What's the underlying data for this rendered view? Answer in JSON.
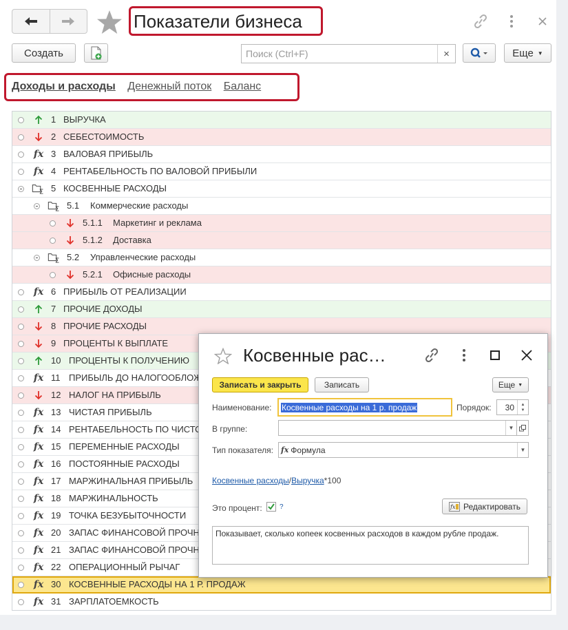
{
  "window": {
    "title": "Показатели бизнеса",
    "back_icon": "arrow-left-icon",
    "forward_icon": "arrow-right-icon"
  },
  "toolbar": {
    "create_label": "Создать",
    "search_placeholder": "Поиск (Ctrl+F)",
    "clear_label": "×",
    "more_label": "Еще"
  },
  "tabs": [
    {
      "label": "Доходы и расходы",
      "active": true
    },
    {
      "label": "Денежный поток",
      "active": false
    },
    {
      "label": "Баланс",
      "active": false
    }
  ],
  "rows": [
    {
      "num": "1",
      "name": "ВЫРУЧКА",
      "kind": "income",
      "icon": "arrow-up-icon",
      "level": 0
    },
    {
      "num": "2",
      "name": "СЕБЕСТОИМОСТЬ",
      "kind": "expense",
      "icon": "arrow-down-icon",
      "level": 0
    },
    {
      "num": "3",
      "name": "ВАЛОВАЯ ПРИБЫЛЬ",
      "kind": "formula",
      "icon": "fx-icon",
      "level": 0
    },
    {
      "num": "4",
      "name": "РЕНТАБЕЛЬНОСТЬ ПО ВАЛОВОЙ ПРИБЫЛИ",
      "kind": "formula",
      "icon": "fx-icon",
      "level": 0
    },
    {
      "num": "5",
      "name": "КОСВЕННЫЕ РАСХОДЫ",
      "kind": "group",
      "icon": "folder-sum-icon",
      "level": 0
    },
    {
      "num": "5.1",
      "name": "Коммерческие расходы",
      "kind": "group",
      "icon": "folder-sum-icon",
      "level": 1
    },
    {
      "num": "5.1.1",
      "name": "Маркетинг и реклама",
      "kind": "expense",
      "icon": "arrow-down-icon",
      "level": 2
    },
    {
      "num": "5.1.2",
      "name": "Доставка",
      "kind": "expense",
      "icon": "arrow-down-icon",
      "level": 2
    },
    {
      "num": "5.2",
      "name": "Управленческие расходы",
      "kind": "group",
      "icon": "folder-sum-icon",
      "level": 1
    },
    {
      "num": "5.2.1",
      "name": "Офисные расходы",
      "kind": "expense",
      "icon": "arrow-down-icon",
      "level": 2
    },
    {
      "num": "6",
      "name": "ПРИБЫЛЬ ОТ РЕАЛИЗАЦИИ",
      "kind": "formula",
      "icon": "fx-icon",
      "level": 0
    },
    {
      "num": "7",
      "name": "ПРОЧИЕ ДОХОДЫ",
      "kind": "income",
      "icon": "arrow-up-icon",
      "level": 0
    },
    {
      "num": "8",
      "name": "ПРОЧИЕ РАСХОДЫ",
      "kind": "expense",
      "icon": "arrow-down-icon",
      "level": 0
    },
    {
      "num": "9",
      "name": "ПРОЦЕНТЫ К ВЫПЛАТЕ",
      "kind": "expense",
      "icon": "arrow-down-icon",
      "level": 0
    },
    {
      "num": "10",
      "name": "ПРОЦЕНТЫ К ПОЛУЧЕНИЮ",
      "kind": "income",
      "icon": "arrow-up-icon",
      "level": 0
    },
    {
      "num": "11",
      "name": "ПРИБЫЛЬ ДО НАЛОГООБЛОЖ",
      "kind": "formula",
      "icon": "fx-icon",
      "level": 0
    },
    {
      "num": "12",
      "name": "НАЛОГ НА ПРИБЫЛЬ",
      "kind": "expense",
      "icon": "arrow-down-icon",
      "level": 0
    },
    {
      "num": "13",
      "name": "ЧИСТАЯ ПРИБЫЛЬ",
      "kind": "formula",
      "icon": "fx-icon",
      "level": 0
    },
    {
      "num": "14",
      "name": "РЕНТАБЕЛЬНОСТЬ ПО ЧИСТО",
      "kind": "formula",
      "icon": "fx-icon",
      "level": 0
    },
    {
      "num": "15",
      "name": "ПЕРЕМЕННЫЕ РАСХОДЫ",
      "kind": "formula",
      "icon": "fx-icon",
      "level": 0
    },
    {
      "num": "16",
      "name": "ПОСТОЯННЫЕ РАСХОДЫ",
      "kind": "formula",
      "icon": "fx-icon",
      "level": 0
    },
    {
      "num": "17",
      "name": "МАРЖИНАЛЬНАЯ ПРИБЫЛЬ",
      "kind": "formula",
      "icon": "fx-icon",
      "level": 0
    },
    {
      "num": "18",
      "name": "МАРЖИНАЛЬНОСТЬ",
      "kind": "formula",
      "icon": "fx-icon",
      "level": 0
    },
    {
      "num": "19",
      "name": "ТОЧКА БЕЗУБЫТОЧНОСТИ",
      "kind": "formula",
      "icon": "fx-icon",
      "level": 0
    },
    {
      "num": "20",
      "name": "ЗАПАС ФИНАНСОВОЙ ПРОЧН",
      "kind": "formula",
      "icon": "fx-icon",
      "level": 0
    },
    {
      "num": "21",
      "name": "ЗАПАС ФИНАНСОВОЙ ПРОЧН",
      "kind": "formula",
      "icon": "fx-icon",
      "level": 0
    },
    {
      "num": "22",
      "name": "ОПЕРАЦИОННЫЙ РЫЧАГ",
      "kind": "formula",
      "icon": "fx-icon",
      "level": 0
    },
    {
      "num": "30",
      "name": "КОСВЕННЫЕ РАСХОДЫ НА 1 Р. ПРОДАЖ",
      "kind": "formula",
      "icon": "fx-icon",
      "level": 0,
      "selected": true
    },
    {
      "num": "31",
      "name": "ЗАРПЛАТОЕМКОСТЬ",
      "kind": "formula",
      "icon": "fx-icon",
      "level": 0
    }
  ],
  "dialog": {
    "title": "Косвенные рас…",
    "save_close_label": "Записать и закрыть",
    "save_label": "Записать",
    "more_label": "Еще",
    "name_label": "Наименование:",
    "name_value": "Косвенные расходы на 1 р. продаж",
    "order_label": "Порядок:",
    "order_value": "30",
    "group_label": "В группе:",
    "group_value": "",
    "type_label": "Тип показателя:",
    "type_value": "Формула",
    "formula_link1": "Косвенные расходы",
    "formula_sep": "/",
    "formula_link2": "Выручка",
    "formula_tail": "*100",
    "percent_label": "Это процент:",
    "percent_checked": true,
    "help_label": "?",
    "edit_label": "Редактировать",
    "description": "Показывает, сколько копеек косвенных расходов в каждом рубле продаж."
  },
  "colors": {
    "accent_red": "#c0182d",
    "income_bg": "#ebf8ea",
    "expense_bg": "#fbe4e4",
    "selected_bg": "#fce68f",
    "primary_button": "#fbe54b",
    "link": "#1e5aa8",
    "arrow_up": "#2e9a3a",
    "arrow_down": "#e0312a"
  }
}
